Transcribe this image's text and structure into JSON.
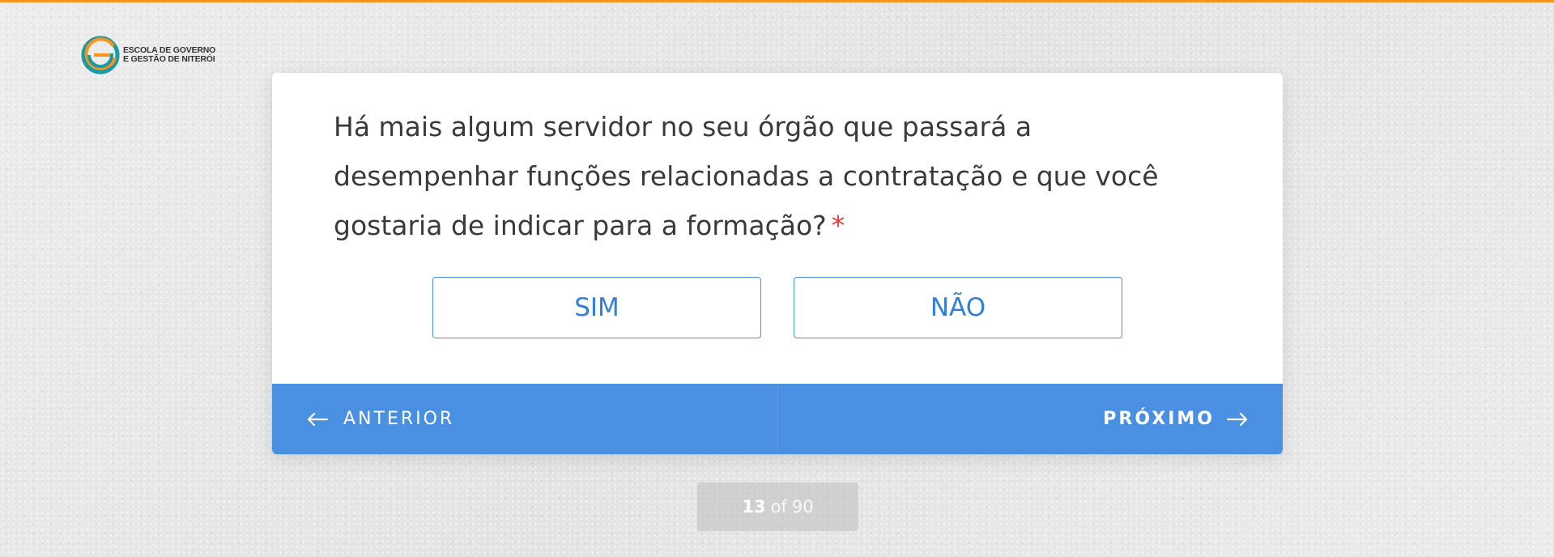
{
  "brand": {
    "name_line1": "ESCOLA DE GOVERNO",
    "name_line2": "E GESTÃO DE NITERÓI",
    "colors": {
      "orange": "#f7931e",
      "teal": "#1a9aa0"
    }
  },
  "question": {
    "text": "Há mais algum servidor no seu órgão que passará a desempenhar funções relacionadas a contratação e que você gostaria de indicar para a formação?",
    "required_marker": "*"
  },
  "options": [
    {
      "label": "SIM"
    },
    {
      "label": "NÃO"
    }
  ],
  "navigation": {
    "prev_label": "ANTERIOR",
    "next_label": "PRÓXIMO",
    "prev_icon": "arrow-left-icon",
    "next_icon": "arrow-right-icon"
  },
  "progress": {
    "current": "13",
    "of_label": "of",
    "total": "90"
  },
  "colors": {
    "accent": "#4a90e2",
    "required": "#e53935",
    "top_bar": "#f7931e"
  }
}
